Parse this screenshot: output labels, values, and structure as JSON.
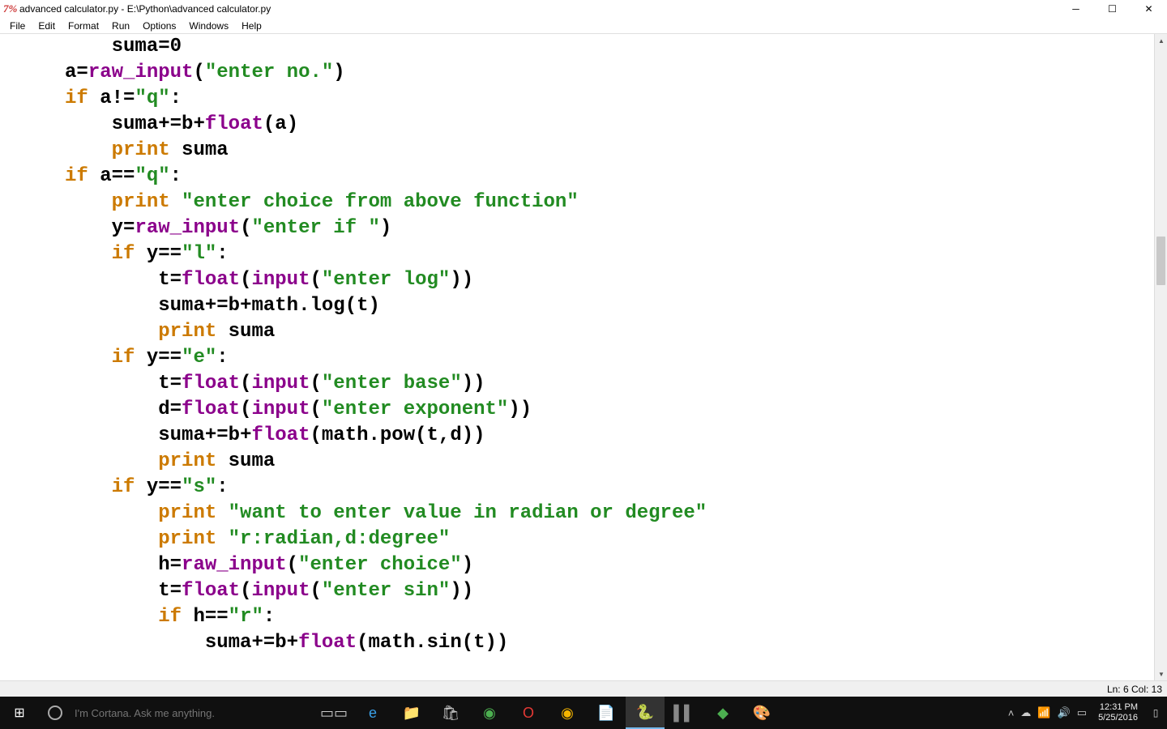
{
  "window": {
    "app_icon": "7%",
    "title": "advanced calculator.py - E:\\Python\\advanced calculator.py"
  },
  "menus": [
    "File",
    "Edit",
    "Format",
    "Run",
    "Options",
    "Windows",
    "Help"
  ],
  "status": {
    "line_col": "Ln: 6 Col: 13"
  },
  "code": {
    "tokens": [
      [
        [
          "id",
          "         suma"
        ],
        [
          "op",
          "="
        ],
        [
          "id",
          "0"
        ]
      ],
      [
        [
          "id",
          "     a"
        ],
        [
          "op",
          "="
        ],
        [
          "fn",
          "raw_input"
        ],
        [
          "op",
          "("
        ],
        [
          "str",
          "\"enter no.\""
        ],
        [
          "op",
          ")"
        ]
      ],
      [
        [
          "id",
          "     "
        ],
        [
          "kw",
          "if"
        ],
        [
          "id",
          " a"
        ],
        [
          "op",
          "!="
        ],
        [
          "str",
          "\"q\""
        ],
        [
          "op",
          ":"
        ]
      ],
      [
        [
          "id",
          "         suma"
        ],
        [
          "op",
          "+="
        ],
        [
          "id",
          "b"
        ],
        [
          "op",
          "+"
        ],
        [
          "fn",
          "float"
        ],
        [
          "op",
          "("
        ],
        [
          "id",
          "a"
        ],
        [
          "op",
          ")"
        ]
      ],
      [
        [
          "id",
          "         "
        ],
        [
          "kw",
          "print"
        ],
        [
          "id",
          " suma"
        ]
      ],
      [
        [
          "id",
          "     "
        ],
        [
          "kw",
          "if"
        ],
        [
          "id",
          " a"
        ],
        [
          "op",
          "=="
        ],
        [
          "str",
          "\"q\""
        ],
        [
          "op",
          ":"
        ]
      ],
      [
        [
          "id",
          "         "
        ],
        [
          "kw",
          "print"
        ],
        [
          "id",
          " "
        ],
        [
          "str",
          "\"enter choice from above function\""
        ]
      ],
      [
        [
          "id",
          "         y"
        ],
        [
          "op",
          "="
        ],
        [
          "fn",
          "raw_input"
        ],
        [
          "op",
          "("
        ],
        [
          "str",
          "\"enter if \""
        ],
        [
          "op",
          ")"
        ]
      ],
      [
        [
          "id",
          "         "
        ],
        [
          "kw",
          "if"
        ],
        [
          "id",
          " y"
        ],
        [
          "op",
          "=="
        ],
        [
          "str",
          "\"l\""
        ],
        [
          "op",
          ":"
        ]
      ],
      [
        [
          "id",
          "             t"
        ],
        [
          "op",
          "="
        ],
        [
          "fn",
          "float"
        ],
        [
          "op",
          "("
        ],
        [
          "fn",
          "input"
        ],
        [
          "op",
          "("
        ],
        [
          "str",
          "\"enter log\""
        ],
        [
          "op",
          "))"
        ]
      ],
      [
        [
          "id",
          "             suma"
        ],
        [
          "op",
          "+="
        ],
        [
          "id",
          "b"
        ],
        [
          "op",
          "+"
        ],
        [
          "id",
          "math.log"
        ],
        [
          "op",
          "("
        ],
        [
          "id",
          "t"
        ],
        [
          "op",
          ")"
        ]
      ],
      [
        [
          "id",
          "             "
        ],
        [
          "kw",
          "print"
        ],
        [
          "id",
          " suma"
        ]
      ],
      [
        [
          "id",
          "         "
        ],
        [
          "kw",
          "if"
        ],
        [
          "id",
          " y"
        ],
        [
          "op",
          "=="
        ],
        [
          "str",
          "\"e\""
        ],
        [
          "op",
          ":"
        ]
      ],
      [
        [
          "id",
          "             t"
        ],
        [
          "op",
          "="
        ],
        [
          "fn",
          "float"
        ],
        [
          "op",
          "("
        ],
        [
          "fn",
          "input"
        ],
        [
          "op",
          "("
        ],
        [
          "str",
          "\"enter base\""
        ],
        [
          "op",
          "))"
        ]
      ],
      [
        [
          "id",
          "             d"
        ],
        [
          "op",
          "="
        ],
        [
          "fn",
          "float"
        ],
        [
          "op",
          "("
        ],
        [
          "fn",
          "input"
        ],
        [
          "op",
          "("
        ],
        [
          "str",
          "\"enter exponent\""
        ],
        [
          "op",
          "))"
        ]
      ],
      [
        [
          "id",
          "             suma"
        ],
        [
          "op",
          "+="
        ],
        [
          "id",
          "b"
        ],
        [
          "op",
          "+"
        ],
        [
          "fn",
          "float"
        ],
        [
          "op",
          "("
        ],
        [
          "id",
          "math.pow"
        ],
        [
          "op",
          "("
        ],
        [
          "id",
          "t"
        ],
        [
          "op",
          ","
        ],
        [
          "id",
          "d"
        ],
        [
          "op",
          "))"
        ]
      ],
      [
        [
          "id",
          "             "
        ],
        [
          "kw",
          "print"
        ],
        [
          "id",
          " suma"
        ]
      ],
      [
        [
          "id",
          "         "
        ],
        [
          "kw",
          "if"
        ],
        [
          "id",
          " y"
        ],
        [
          "op",
          "=="
        ],
        [
          "str",
          "\"s\""
        ],
        [
          "op",
          ":"
        ]
      ],
      [
        [
          "id",
          "             "
        ],
        [
          "kw",
          "print"
        ],
        [
          "id",
          " "
        ],
        [
          "str",
          "\"want to enter value in radian or degree\""
        ]
      ],
      [
        [
          "id",
          "             "
        ],
        [
          "kw",
          "print"
        ],
        [
          "id",
          " "
        ],
        [
          "str",
          "\"r:radian,d:degree\""
        ]
      ],
      [
        [
          "id",
          "             h"
        ],
        [
          "op",
          "="
        ],
        [
          "fn",
          "raw_input"
        ],
        [
          "op",
          "("
        ],
        [
          "str",
          "\"enter choice\""
        ],
        [
          "op",
          ")"
        ]
      ],
      [
        [
          "id",
          "             t"
        ],
        [
          "op",
          "="
        ],
        [
          "fn",
          "float"
        ],
        [
          "op",
          "("
        ],
        [
          "fn",
          "input"
        ],
        [
          "op",
          "("
        ],
        [
          "str",
          "\"enter sin\""
        ],
        [
          "op",
          "))"
        ]
      ],
      [
        [
          "id",
          "             "
        ],
        [
          "kw",
          "if"
        ],
        [
          "id",
          " h"
        ],
        [
          "op",
          "=="
        ],
        [
          "str",
          "\"r\""
        ],
        [
          "op",
          ":"
        ]
      ],
      [
        [
          "id",
          "                 suma"
        ],
        [
          "op",
          "+="
        ],
        [
          "id",
          "b"
        ],
        [
          "op",
          "+"
        ],
        [
          "fn",
          "float"
        ],
        [
          "op",
          "("
        ],
        [
          "id",
          "math.sin"
        ],
        [
          "op",
          "("
        ],
        [
          "id",
          "t"
        ],
        [
          "op",
          "))"
        ]
      ]
    ]
  },
  "taskbar": {
    "cortana_placeholder": "I'm Cortana. Ask me anything.",
    "clock_time": "12:31 PM",
    "clock_date": "5/25/2016",
    "apps": [
      {
        "name": "task-view",
        "glyph": "▭▭",
        "color": "#ccc"
      },
      {
        "name": "edge",
        "glyph": "e",
        "color": "#3aa0e8"
      },
      {
        "name": "file-explorer",
        "glyph": "📁",
        "color": "#f6c24a"
      },
      {
        "name": "store",
        "glyph": "🛍",
        "color": "#ccc"
      },
      {
        "name": "utorrent",
        "glyph": "◉",
        "color": "#4caf50"
      },
      {
        "name": "opera",
        "glyph": "O",
        "color": "#e53935"
      },
      {
        "name": "chrome",
        "glyph": "◉",
        "color": "#f4b400"
      },
      {
        "name": "notepadpp",
        "glyph": "📄",
        "color": "#88c057"
      },
      {
        "name": "idle",
        "glyph": "🐍",
        "color": "#3776ab",
        "active": true
      },
      {
        "name": "pycharm",
        "glyph": "▌▌",
        "color": "#888"
      },
      {
        "name": "drive",
        "glyph": "◆",
        "color": "#4caf50"
      },
      {
        "name": "paint",
        "glyph": "🎨",
        "color": "#e0a050"
      }
    ]
  }
}
